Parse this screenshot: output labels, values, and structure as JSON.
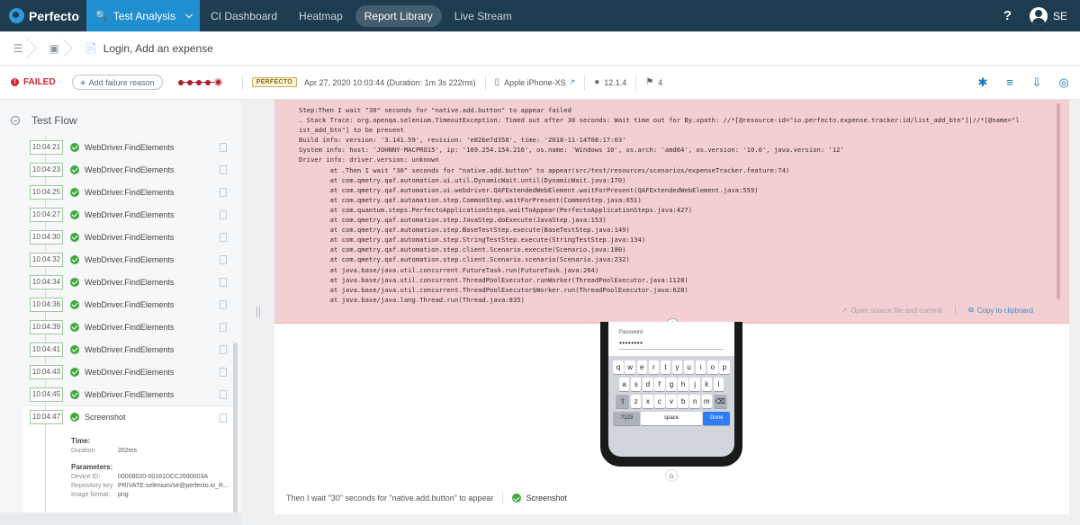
{
  "nav": {
    "brand": "Perfecto",
    "active_tab": "Test Analysis",
    "links": [
      "CI Dashboard",
      "Heatmap",
      "Report Library",
      "Live Stream"
    ],
    "help": "?",
    "user_initials": "SE"
  },
  "breadcrumb": {
    "title": "Login, Add an expense"
  },
  "status": {
    "result": "FAILED",
    "add_reason": "Add failure reason",
    "badge": "PERFECTO",
    "datetime": "Apr 27, 2020 10:03:44 (Duration: 1m 3s 222ms)",
    "device": "Apple iPhone-XS",
    "os_version": "12.1.4",
    "tags_count": "4"
  },
  "flow": {
    "title": "Test Flow",
    "steps": [
      {
        "time": "10:04:21",
        "name": "WebDriver.FindElements"
      },
      {
        "time": "10:04:23",
        "name": "WebDriver.FindElements"
      },
      {
        "time": "10:04:25",
        "name": "WebDriver.FindElements"
      },
      {
        "time": "10:04:27",
        "name": "WebDriver.FindElements"
      },
      {
        "time": "10:04:30",
        "name": "WebDriver.FindElements"
      },
      {
        "time": "10:04:32",
        "name": "WebDriver.FindElements"
      },
      {
        "time": "10:04:34",
        "name": "WebDriver.FindElements"
      },
      {
        "time": "10:04:36",
        "name": "WebDriver.FindElements"
      },
      {
        "time": "10:04:39",
        "name": "WebDriver.FindElements"
      },
      {
        "time": "10:04:41",
        "name": "WebDriver.FindElements"
      },
      {
        "time": "10:04:43",
        "name": "WebDriver.FindElements"
      },
      {
        "time": "10:04:45",
        "name": "WebDriver.FindElements"
      },
      {
        "time": "10:04:47",
        "name": "Screenshot"
      }
    ],
    "details": {
      "time_label": "Time:",
      "duration_key": "Duration:",
      "duration_val": "202ms",
      "params_label": "Parameters:",
      "device_id_key": "Device ID:",
      "device_id_val": "00008020-00161DCC2690003A",
      "repo_key": "Repository key:",
      "repo_val": "PRIVATE:selenium/se@perfecto.io_R...",
      "format_key": "Image format:",
      "format_val": "png"
    }
  },
  "error": {
    "lines": [
      "Step:Then I wait \"30\" seconds for \"native.add.button\" to appear failed",
      ". Stack Trace: org.openqa.selenium.TimeoutException: Timed out after 30 seconds: Wait time out for By.xpath: //*[@resource-id=\"io.perfecto.expense.tracker:id/list_add_btn\"]|//*[@name=\"l",
      "ist_add_btn\"] to be present",
      "Build info: version: '3.141.59', revision: 'e82be7d358', time: '2018-11-14T08:17:03'",
      "System info: host: 'JOHNNY-MACPRO15', ip: '169.254.154.216', os.name: 'Windows 10', os.arch: 'amd64', os.version: '10.0', java.version: '12'",
      "Driver info: driver.version: unknown",
      "        at .Then I wait \"30\" seconds for \"native.add.button\" to appear(src/test/resources/scenarios/expenseTracker.feature:74)",
      "        at com.qmetry.qaf.automation.ui.util.DynamicWait.until(DynamicWait.java:170)",
      "        at com.qmetry.qaf.automation.ui.webdriver.QAFExtendedWebElement.waitForPresent(QAFExtendedWebElement.java:559)",
      "        at com.qmetry.qaf.automation.step.CommonStep.waitForPresent(CommonStep.java:651)",
      "        at com.quantum.steps.PerfectoApplicationSteps.waitToAppear(PerfectoApplicationSteps.java:427)",
      "        at com.qmetry.qaf.automation.step.JavaStep.doExecute(JavaStep.java:153)",
      "        at com.qmetry.qaf.automation.step.BaseTestStep.execute(BaseTestStep.java:149)",
      "        at com.qmetry.qaf.automation.step.StringTestStep.execute(StringTestStep.java:134)",
      "        at com.qmetry.qaf.automation.step.client.Scenario.execute(Scenario.java:180)",
      "        at com.qmetry.qaf.automation.step.client.Scenario.scenario(Scenario.java:232)",
      "        at java.base/java.util.concurrent.FutureTask.run(FutureTask.java:264)",
      "        at java.base/java.util.concurrent.ThreadPoolExecutor.runWorker(ThreadPoolExecutor.java:1128)",
      "        at java.base/java.util.concurrent.ThreadPoolExecutor$Worker.run(ThreadPoolExecutor.java:628)",
      "        at java.base/java.lang.Thread.run(Thread.java:835)"
    ],
    "open_source": "Open source file and commit",
    "copy": "Copy to clipboard"
  },
  "phone": {
    "password_label": "Password",
    "password_value": "••••••••",
    "keyboard": {
      "row1": [
        "q",
        "w",
        "e",
        "r",
        "t",
        "y",
        "u",
        "i",
        "o",
        "p"
      ],
      "row2": [
        "a",
        "s",
        "d",
        "f",
        "g",
        "h",
        "j",
        "k",
        "l"
      ],
      "row3": [
        "z",
        "x",
        "c",
        "v",
        "b",
        "n",
        "m"
      ],
      "num_key": ".?123",
      "space_key": "space",
      "done_key": "Done"
    }
  },
  "footer": {
    "step_text": "Then I wait \"30\" seconds for \"native.add.button\" to appear",
    "screenshot_label": "Screenshot"
  },
  "colors": {
    "nav_bg": "#1f3b4f",
    "accent": "#1f8fd0",
    "failed": "#d32535",
    "success": "#3fa83f",
    "error_bg": "#f3cfd4"
  }
}
